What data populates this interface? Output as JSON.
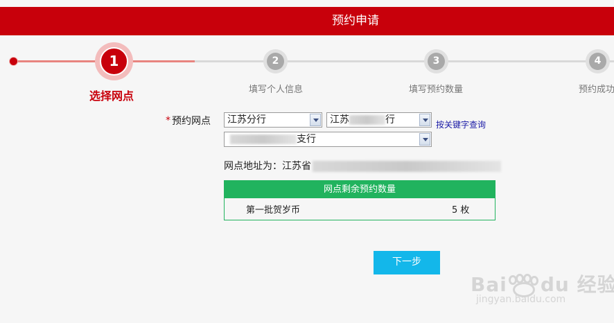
{
  "header": {
    "title": "预约申请"
  },
  "steps": [
    {
      "number": "1",
      "label": "选择网点"
    },
    {
      "number": "2",
      "label": "填写个人信息"
    },
    {
      "number": "3",
      "label": "填写预约数量"
    },
    {
      "number": "4",
      "label": "预约成功"
    }
  ],
  "form": {
    "required_mark": "*",
    "label": "预约网点",
    "branch_select": "江苏分行",
    "city_select_prefix": "江苏",
    "city_select_suffix": "行",
    "subbranch_select_suffix": "支行",
    "keyword_link": "按关键字查询",
    "address_prefix": "网点地址为：江苏省"
  },
  "quota_table": {
    "header": "网点剩余预约数量",
    "rows": [
      {
        "name": "第一批贺岁币",
        "quantity": "5  枚"
      }
    ]
  },
  "next_button": "下一步",
  "watermark": {
    "brand": "Bai du 经验",
    "url": "jingyan.baidu.com"
  },
  "colors": {
    "brand_red": "#c8000b",
    "table_green": "#21b35e",
    "button_blue": "#13b7ea"
  }
}
